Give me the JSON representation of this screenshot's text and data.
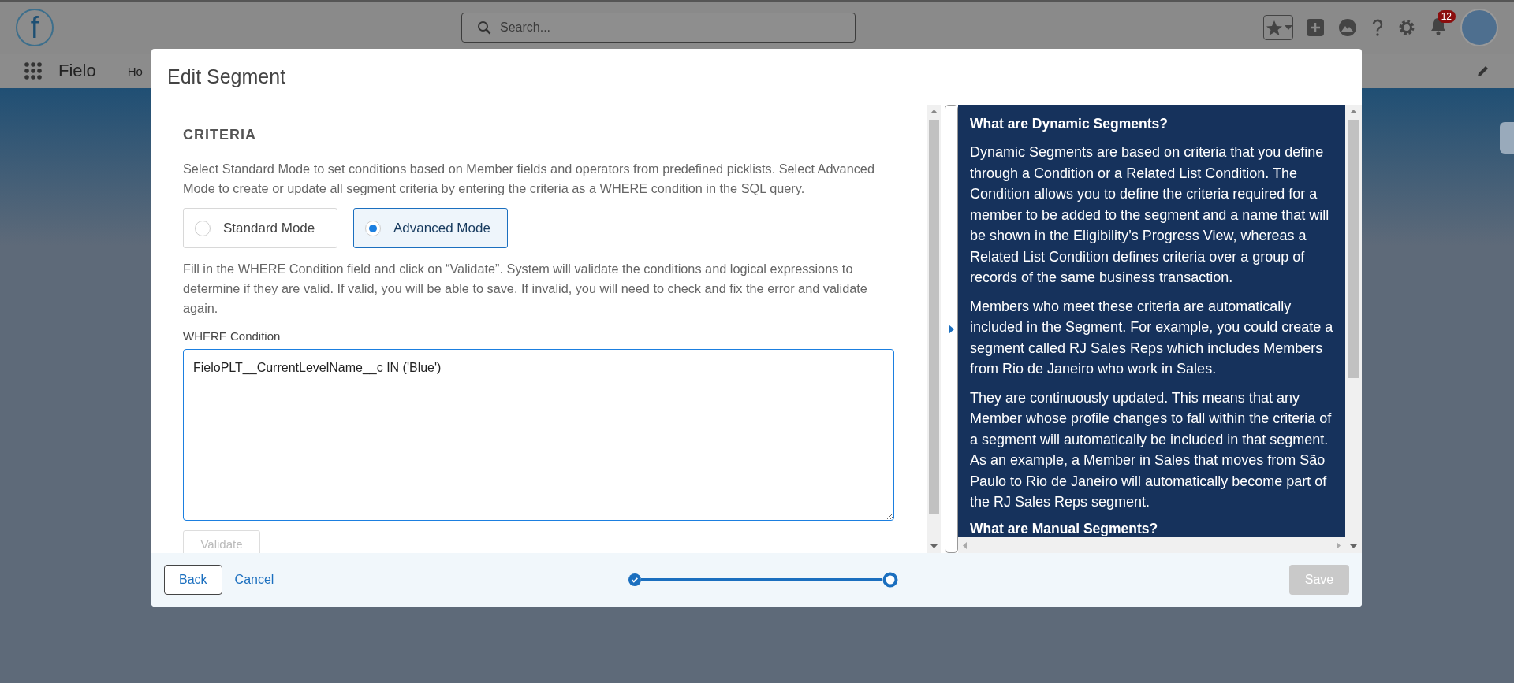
{
  "app_header": {
    "logo": "f",
    "search": {
      "placeholder": "Search..."
    },
    "notification_count": "12"
  },
  "nav": {
    "app_name": "Fielo",
    "tab_1": "Ho"
  },
  "modal": {
    "title": "Edit Segment",
    "section_title": "CRITERIA",
    "intro": "Select Standard Mode to set conditions based on Member fields and operators from predefined picklists. Select Advanced Mode to create or update all segment criteria by entering the criteria as a WHERE condition in the SQL query.",
    "modes": [
      {
        "label": "Standard Mode",
        "selected": false
      },
      {
        "label": "Advanced Mode",
        "selected": true
      }
    ],
    "instructions": "Fill in the WHERE Condition field and click on “Validate”. System will validate the conditions and logical expressions to determine if they are valid. If valid, you will be able to save. If invalid, you will need to check and fix the error and validate again.",
    "where_field": {
      "label": "WHERE Condition",
      "value": "FieloPLT__CurrentLevelName__c IN ('Blue')"
    },
    "validate_button": {
      "label": "Validate",
      "disabled": true
    }
  },
  "help_panel": {
    "sections": [
      {
        "heading": "What are Dynamic Segments?",
        "paragraphs": [
          "Dynamic Segments are based on criteria that you define through a Condition or a Related List Condition. The Condition allows you to define the criteria required for a member to be added to the segment and a name that will be shown in the Eligibility’s Progress View, whereas a Related List Condition defines criteria over a group of records of the same business transaction.",
          "Members who meet these criteria are automatically included in the Segment. For example, you could create a segment called RJ Sales Reps which includes Members from Rio de Janeiro who work in Sales.",
          "They are continuously updated. This means that any Member whose profile changes to fall within the criteria of a segment will automatically be included in that segment. As an example, a Member in Sales that moves from São Paulo to Rio de Janeiro will automatically become part of the RJ Sales Reps segment."
        ]
      },
      {
        "heading": "What are Manual Segments?"
      }
    ]
  },
  "footer": {
    "back": "Back",
    "cancel": "Cancel",
    "steps": [
      {
        "completed": true
      },
      {
        "completed": false
      }
    ],
    "save_button": {
      "label": "Save",
      "disabled": true
    }
  }
}
